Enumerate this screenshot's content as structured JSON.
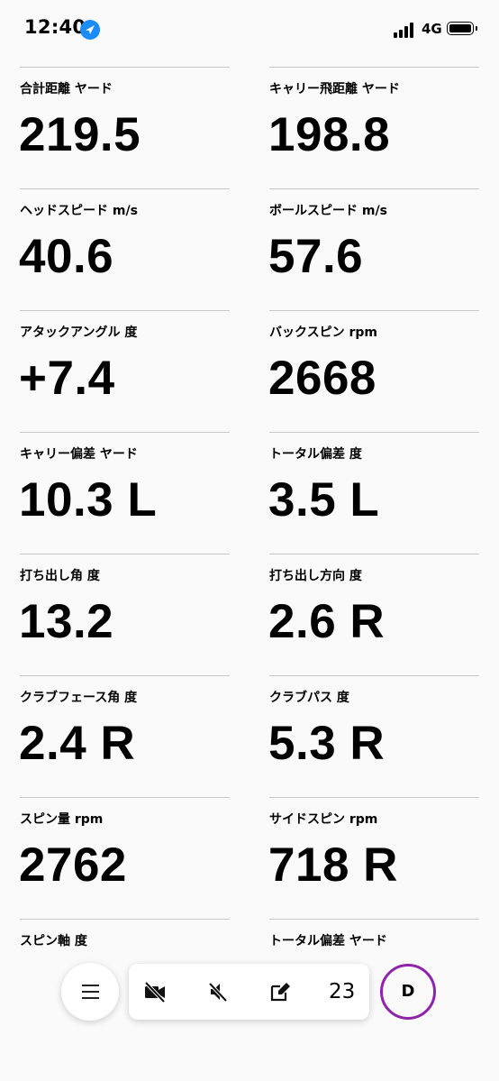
{
  "status_bar": {
    "time": "12:40",
    "network": "4G"
  },
  "metrics": [
    {
      "label": "合計距離 ヤード",
      "value": "219.5"
    },
    {
      "label": "キャリー飛距離 ヤード",
      "value": "198.8"
    },
    {
      "label": "ヘッドスピード m/s",
      "value": "40.6"
    },
    {
      "label": "ボールスピード m/s",
      "value": "57.6"
    },
    {
      "label": "アタックアングル 度",
      "value": "+7.4"
    },
    {
      "label": "バックスピン rpm",
      "value": "2668"
    },
    {
      "label": "キャリー偏差 ヤード",
      "value": "10.3 L"
    },
    {
      "label": "トータル偏差 度",
      "value": "3.5 L"
    },
    {
      "label": "打ち出し角 度",
      "value": "13.2"
    },
    {
      "label": "打ち出し方向 度",
      "value": "2.6 R"
    },
    {
      "label": "クラブフェース角 度",
      "value": "2.4 R"
    },
    {
      "label": "クラブパス 度",
      "value": "5.3 R"
    },
    {
      "label": "スピン量 rpm",
      "value": "2762"
    },
    {
      "label": "サイドスピン rpm",
      "value": "718 R"
    },
    {
      "label": "スピン軸 度",
      "value": ""
    },
    {
      "label": "トータル偏差 ヤード",
      "value": ""
    }
  ],
  "toolbar": {
    "count": "23"
  },
  "profile": {
    "initial": "D",
    "ring_color": "#8e24aa"
  },
  "colors": {
    "location_icon": "#1a8cff",
    "divider": "#c8c8c8"
  }
}
